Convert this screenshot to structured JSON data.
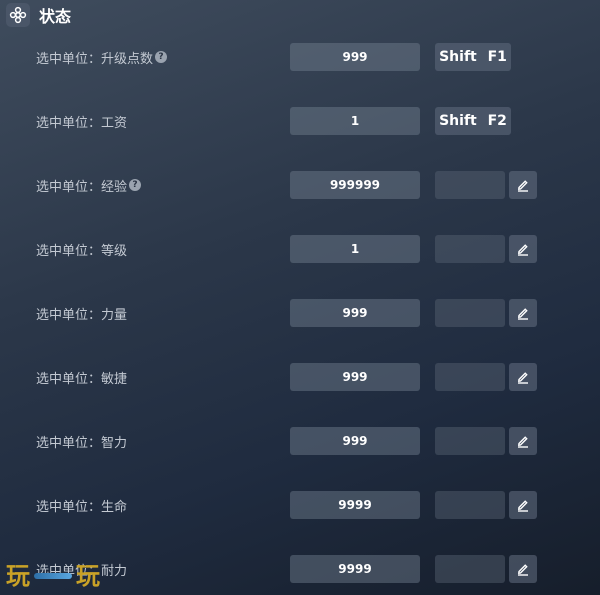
{
  "header": {
    "title": "状态",
    "icon": "plus-gear-icon"
  },
  "rows": [
    {
      "label": "选中单位：升级点数",
      "help": true,
      "value": "999",
      "control": "hotkey",
      "hotkey": "Shift F1"
    },
    {
      "label": "选中单位：工资",
      "help": false,
      "value": "1",
      "control": "hotkey",
      "hotkey": "Shift F2"
    },
    {
      "label": "选中单位：经验",
      "help": true,
      "value": "999999",
      "control": "edit"
    },
    {
      "label": "选中单位：等级",
      "help": false,
      "value": "1",
      "control": "edit"
    },
    {
      "label": "选中单位：力量",
      "help": false,
      "value": "999",
      "control": "edit"
    },
    {
      "label": "选中单位：敏捷",
      "help": false,
      "value": "999",
      "control": "edit"
    },
    {
      "label": "选中单位：智力",
      "help": false,
      "value": "999",
      "control": "edit"
    },
    {
      "label": "选中单位：生命",
      "help": false,
      "value": "9999",
      "control": "edit"
    },
    {
      "label": "选中单位：耐力",
      "help": false,
      "value": "9999",
      "control": "edit"
    }
  ],
  "watermark": {
    "left": "玩",
    "right": "玩"
  },
  "colors": {
    "label": "#c3c9d2",
    "value_text": "#ffffff",
    "watermark": "#c9a227"
  }
}
